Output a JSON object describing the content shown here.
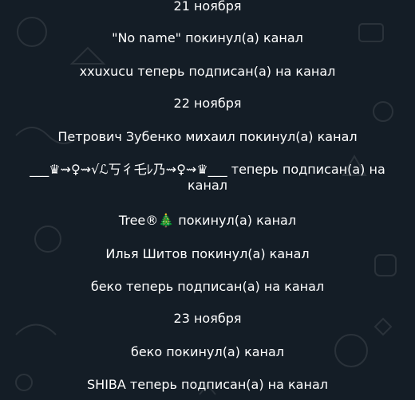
{
  "feed": {
    "items": [
      {
        "kind": "date",
        "text": "21 ноября"
      },
      {
        "kind": "service",
        "text": "\"No name\" покинул(а) канал"
      },
      {
        "kind": "service",
        "text": "xxuxucu теперь подписан(а) на канал"
      },
      {
        "kind": "date",
        "text": "22 ноября"
      },
      {
        "kind": "service",
        "text": "Петрович Зубенко михаил покинул(а) канал"
      },
      {
        "kind": "service",
        "text": "___♛⇝♀⇝√ℒ丂彳乇ﾚ乃⇝♀⇝♛___ теперь подписан(а) на канал"
      },
      {
        "kind": "service",
        "text": "Tree®🎄 покинул(а) канал"
      },
      {
        "kind": "service",
        "text": "Илья Шитов покинул(а) канал"
      },
      {
        "kind": "service",
        "text": "беко теперь подписан(а) на канал"
      },
      {
        "kind": "date",
        "text": "23 ноября"
      },
      {
        "kind": "service",
        "text": "беко покинул(а) канал"
      },
      {
        "kind": "service",
        "text": "SHIBA теперь подписан(а) на канал"
      }
    ]
  },
  "colors": {
    "background": "#141d26",
    "text": "#ffffff"
  }
}
